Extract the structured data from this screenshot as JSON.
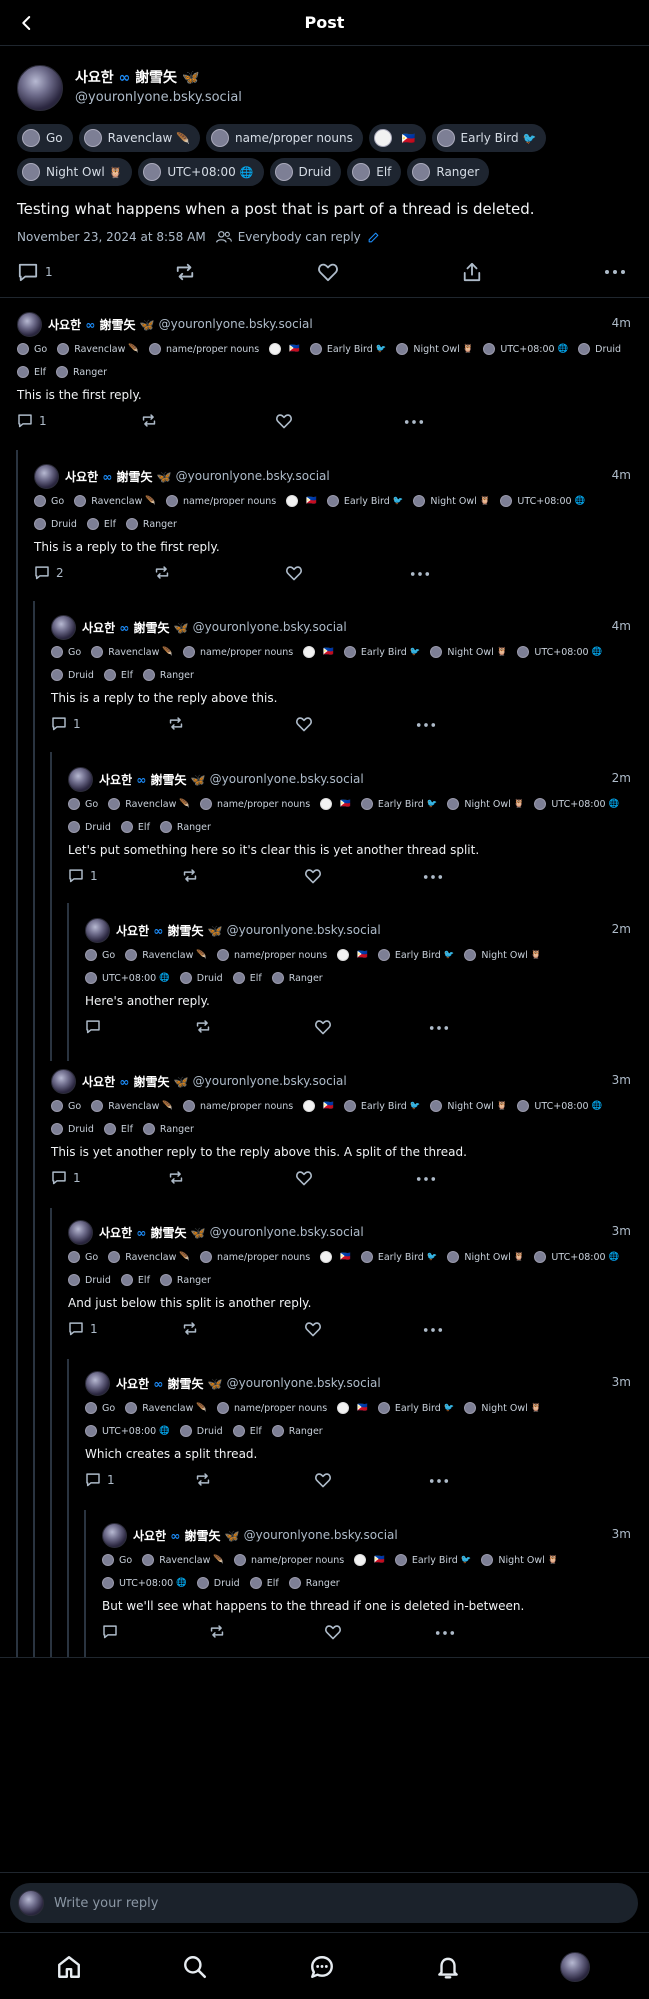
{
  "header": {
    "title": "Post"
  },
  "root": {
    "display_name": "사요한",
    "display_name_suffix": "謝雪矢",
    "handle": "@youronlyone.bsky.social",
    "labels": [
      {
        "text": "Go",
        "emoji": ""
      },
      {
        "text": "Ravenclaw",
        "emoji": "🪶"
      },
      {
        "text": "name/proper nouns",
        "emoji": ""
      },
      {
        "text": "",
        "emoji": "🇵🇭"
      },
      {
        "text": "Early Bird",
        "emoji": "🐦"
      },
      {
        "text": "Night Owl",
        "emoji": "🦉"
      },
      {
        "text": "UTC+08:00",
        "emoji": "🌐"
      },
      {
        "text": "Druid",
        "emoji": ""
      },
      {
        "text": "Elf",
        "emoji": ""
      },
      {
        "text": "Ranger",
        "emoji": ""
      }
    ],
    "text": "Testing what happens when a post that is part of a thread is deleted.",
    "date": "November 23, 2024 at 8:58 AM",
    "reply_setting": "Everybody can reply",
    "reply_count": "1"
  },
  "replies": [
    {
      "time": "4m",
      "text": "This is the first reply.",
      "reply_count": "1"
    },
    {
      "time": "4m",
      "text": "This is a reply to the first reply.",
      "reply_count": "2"
    },
    {
      "time": "4m",
      "text": "This is a reply to the reply above this.",
      "reply_count": "1"
    },
    {
      "time": "2m",
      "text": "Let's put something here so it's clear this is yet another thread split.",
      "reply_count": "1"
    },
    {
      "time": "2m",
      "text": "Here's another reply.",
      "reply_count": ""
    },
    {
      "time": "3m",
      "text": "This is yet another reply to the reply above this. A split of the thread.",
      "reply_count": "1"
    },
    {
      "time": "3m",
      "text": "And just below this split is another reply.",
      "reply_count": "1"
    },
    {
      "time": "3m",
      "text": "Which creates a split thread.",
      "reply_count": "1"
    },
    {
      "time": "3m",
      "text": "But we'll see what happens to the thread if one is deleted in-between.",
      "reply_count": ""
    }
  ],
  "composer": {
    "placeholder": "Write your reply"
  },
  "tabs": [
    "home-icon",
    "search-icon",
    "chat-icon",
    "bell-icon",
    "profile-avatar"
  ],
  "colors": {
    "background": "#000000",
    "chip": "#1e2530",
    "text_muted": "#aebbc9",
    "accent": "#1d8cf8",
    "thread_line": "#2a3440"
  }
}
